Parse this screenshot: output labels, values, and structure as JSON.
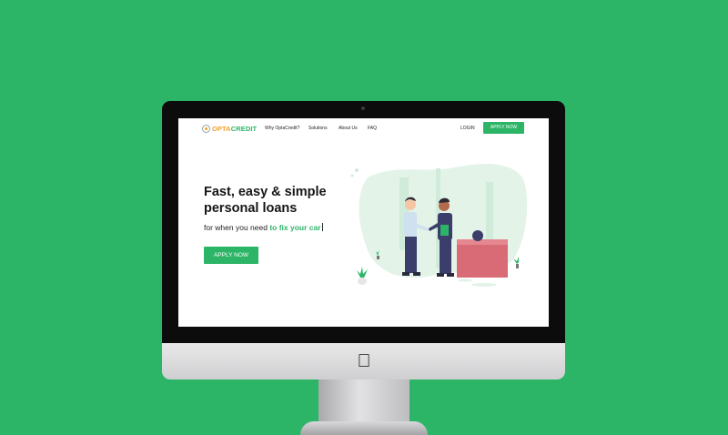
{
  "brand": {
    "name_part1": "OPTA",
    "name_part2": "CREDIT",
    "color_primary": "#2db567",
    "color_accent": "#f0a12b"
  },
  "nav": {
    "links": [
      "Why OptaCredit?",
      "Solutions",
      "About Us",
      "FAQ"
    ],
    "login_label": "LOGIN",
    "apply_label": "APPLY NOW"
  },
  "hero": {
    "title": "Fast, easy & simple personal loans",
    "subtitle_prefix": "for when you need ",
    "subtitle_highlight": "to fix your car",
    "cta_label": "APPLY NOW"
  },
  "device": {
    "background_color": "#2db567",
    "logo_icon": "apple-icon"
  }
}
